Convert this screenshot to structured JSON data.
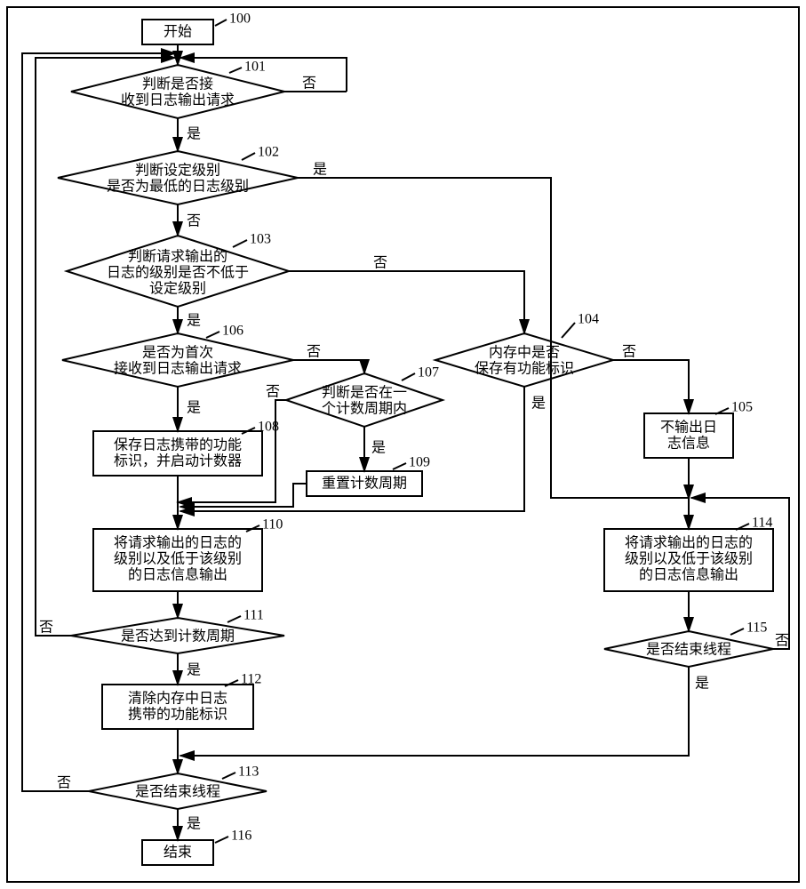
{
  "nodes": {
    "n100": {
      "num": "100",
      "text": "开始"
    },
    "n101": {
      "num": "101",
      "l1": "判断是否接",
      "l2": "收到日志输出请求"
    },
    "n102": {
      "num": "102",
      "l1": "判断设定级别",
      "l2": "是否为最低的日志级别"
    },
    "n103": {
      "num": "103",
      "l1": "判断请求输出的",
      "l2": "日志的级别是否不低于",
      "l3": "设定级别"
    },
    "n104": {
      "num": "104",
      "l1": "内存中是否",
      "l2": "保存有功能标识"
    },
    "n105": {
      "num": "105",
      "l1": "不输出日",
      "l2": "志信息"
    },
    "n106": {
      "num": "106",
      "l1": "是否为首次",
      "l2": "接收到日志输出请求"
    },
    "n107": {
      "num": "107",
      "l1": "判断是否在一",
      "l2": "个计数周期内"
    },
    "n108": {
      "num": "108",
      "l1": "保存日志携带的功能",
      "l2": "标识，并启动计数器"
    },
    "n109": {
      "num": "109",
      "l1": "重置计数周期"
    },
    "n110": {
      "num": "110",
      "l1": "将请求输出的日志的",
      "l2": "级别以及低于该级别",
      "l3": "的日志信息输出"
    },
    "n111": {
      "num": "111",
      "l1": "是否达到计数周期"
    },
    "n112": {
      "num": "112",
      "l1": "清除内存中日志",
      "l2": "携带的功能标识"
    },
    "n113": {
      "num": "113",
      "l1": "是否结束线程"
    },
    "n114": {
      "num": "114",
      "l1": "将请求输出的日志的",
      "l2": "级别以及低于该级别",
      "l3": "的日志信息输出"
    },
    "n115": {
      "num": "115",
      "l1": "是否结束线程"
    },
    "n116": {
      "num": "116",
      "text": "结束"
    }
  },
  "labels": {
    "yes": "是",
    "no": "否"
  }
}
